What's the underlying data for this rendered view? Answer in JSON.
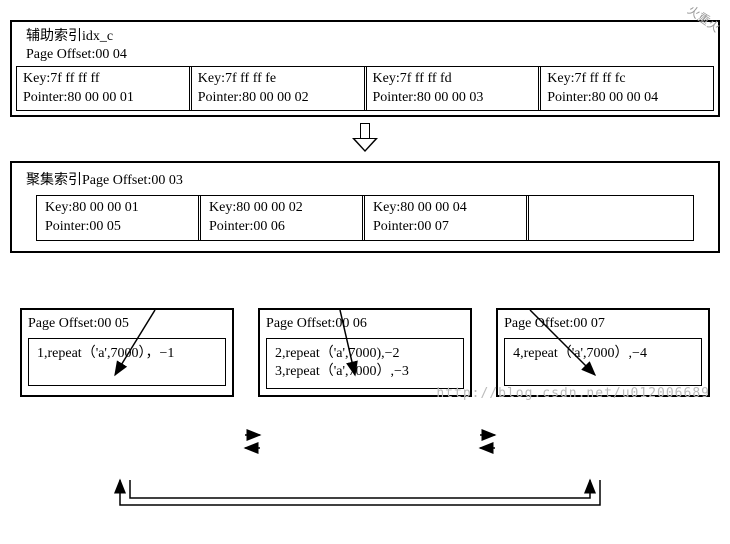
{
  "secondary_index": {
    "title": "辅助索引idx_c",
    "offset_label": "Page Offset:00 04",
    "entries": [
      {
        "key": "Key:7f ff ff ff",
        "ptr": "Pointer:80 00 00 01"
      },
      {
        "key": "Key:7f ff ff fe",
        "ptr": "Pointer:80 00 00 02"
      },
      {
        "key": "Key:7f ff ff fd",
        "ptr": "Pointer:80 00 00 03"
      },
      {
        "key": "Key:7f ff ff fc",
        "ptr": "Pointer:80 00 00 04"
      }
    ]
  },
  "clustered_index": {
    "title": "聚集索引Page Offset:00 03",
    "entries": [
      {
        "key": "Key:80 00 00 01",
        "ptr": "Pointer:00 05"
      },
      {
        "key": "Key:80 00 00 02",
        "ptr": "Pointer:00 06"
      },
      {
        "key": "Key:80 00 00 04",
        "ptr": "Pointer:00 07"
      }
    ]
  },
  "leaves": [
    {
      "title": "Page Offset:00 05",
      "body": "1,repeat（'a',7000），−1"
    },
    {
      "title": "Page Offset:00 06",
      "line1": "2,repeat（'a',7000),−2",
      "line2": "3,repeat（'a',7000）,−3"
    },
    {
      "title": "Page Offset:00 07",
      "body": "4,repeat（'a',7000）,−4"
    }
  ],
  "watermark": "http://blog.csdn.net/u012006689",
  "corner": "火重火"
}
